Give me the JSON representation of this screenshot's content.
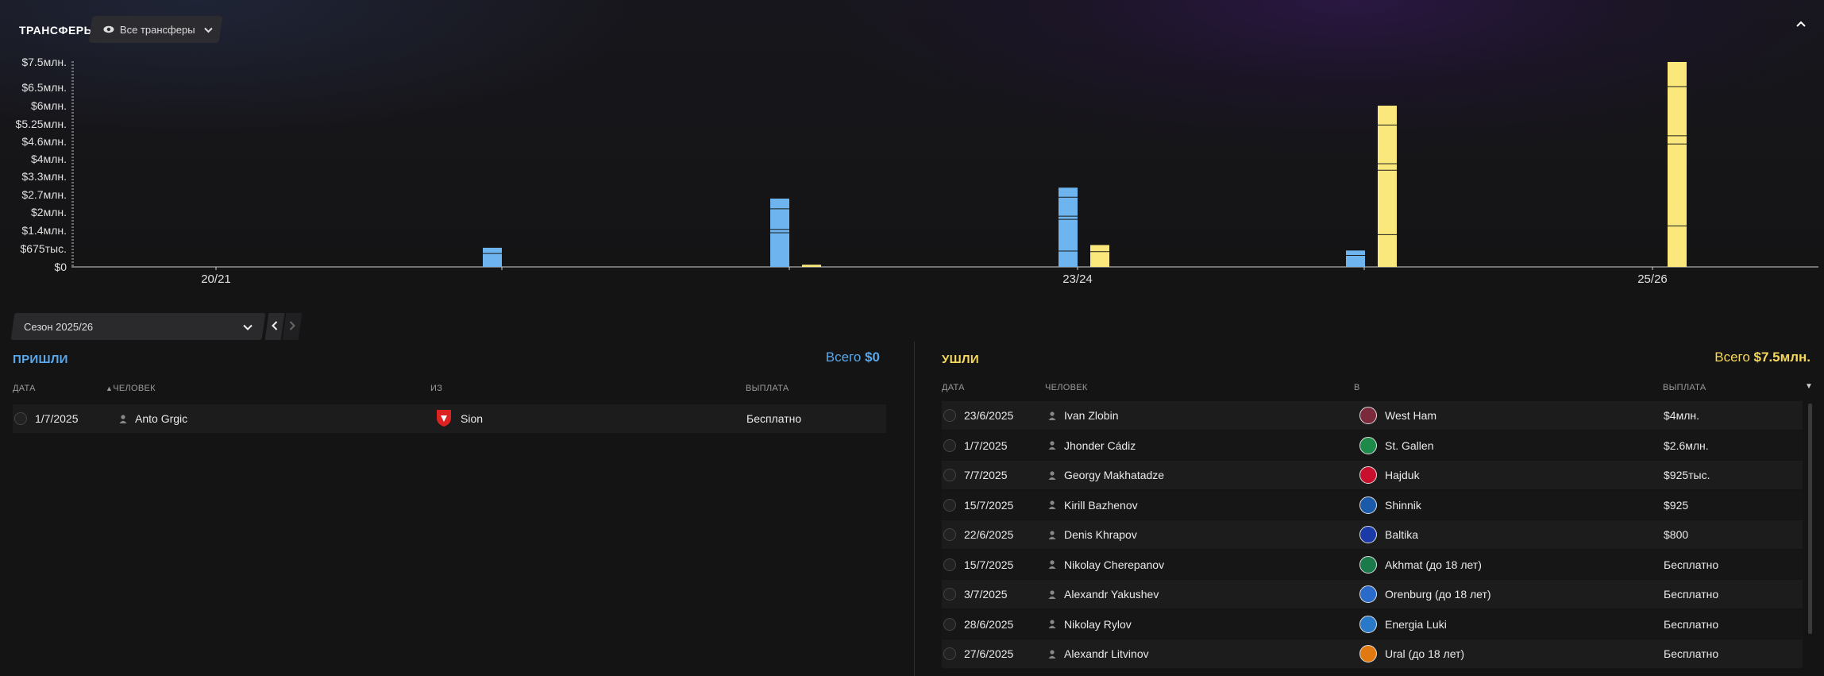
{
  "header": {
    "title": "ТРАНСФЕРЫ",
    "filter_label": "Все трансферы"
  },
  "chart_data": {
    "type": "bar",
    "y_ticks": [
      "$7.5млн.",
      "$6.5млн.",
      "$6млн.",
      "$5.25млн.",
      "$4.6млн.",
      "$4млн.",
      "$3.3млн.",
      "$2.7млн.",
      "$2млн.",
      "$1.4млн.",
      "$675тыс.",
      "$0"
    ],
    "x_labels": [
      "20/21",
      "23/24",
      "25/26"
    ],
    "ylim": [
      0,
      7.5
    ],
    "series": [
      {
        "name": "",
        "color": "#6eb4ee",
        "values": [
          0,
          0.7,
          2.5,
          2.9,
          0.6,
          0
        ]
      },
      {
        "name": "",
        "color": "#fbe87c",
        "values": [
          0,
          0,
          0.08,
          0.8,
          5.9,
          7.5
        ]
      }
    ],
    "categories": [
      "",
      "",
      "",
      "",
      "",
      ""
    ]
  },
  "season": {
    "label": "Сезон 2025/26"
  },
  "incoming": {
    "title": "ПРИШЛИ",
    "total_label": "Всего",
    "total_value": "$0",
    "col_date": "ДАТА",
    "col_person": "ЧЕЛОВЕК",
    "col_from": "ИЗ",
    "col_fee": "ВЫПЛАТА",
    "rows": [
      {
        "date": "1/7/2025",
        "person": "Anto Grgic",
        "club": "Sion",
        "fee": "Бесплатно"
      }
    ]
  },
  "outgoing": {
    "title": "УШЛИ",
    "total_label": "Всего",
    "total_value": "$7.5млн.",
    "col_date": "ДАТА",
    "col_person": "ЧЕЛОВЕК",
    "col_to": "В",
    "col_fee": "ВЫПЛАТА",
    "rows": [
      {
        "date": "23/6/2025",
        "person": "Ivan Zlobin",
        "club": "West Ham",
        "fee": "$4млн."
      },
      {
        "date": "1/7/2025",
        "person": "Jhonder Cádiz",
        "club": "St. Gallen",
        "fee": "$2.6млн."
      },
      {
        "date": "7/7/2025",
        "person": "Georgy Makhatadze",
        "club": "Hajduk",
        "fee": "$925тыс."
      },
      {
        "date": "15/7/2025",
        "person": "Kirill Bazhenov",
        "club": "Shinnik",
        "fee": "$925"
      },
      {
        "date": "22/6/2025",
        "person": "Denis Khrapov",
        "club": "Baltika",
        "fee": "$800"
      },
      {
        "date": "15/7/2025",
        "person": "Nikolay Cherepanov",
        "club": "Akhmat (до 18 лет)",
        "fee": "Бесплатно"
      },
      {
        "date": "3/7/2025",
        "person": "Alexandr Yakushev",
        "club": "Orenburg (до 18 лет)",
        "fee": "Бесплатно"
      },
      {
        "date": "28/6/2025",
        "person": "Nikolay Rylov",
        "club": "Energia Luki",
        "fee": "Бесплатно"
      },
      {
        "date": "27/6/2025",
        "person": "Alexandr Litvinov",
        "club": "Ural (до 18 лет)",
        "fee": "Бесплатно"
      }
    ]
  },
  "colors": {
    "incoming_accent": "#5aa8ec",
    "outgoing_accent": "#f6d85a"
  }
}
